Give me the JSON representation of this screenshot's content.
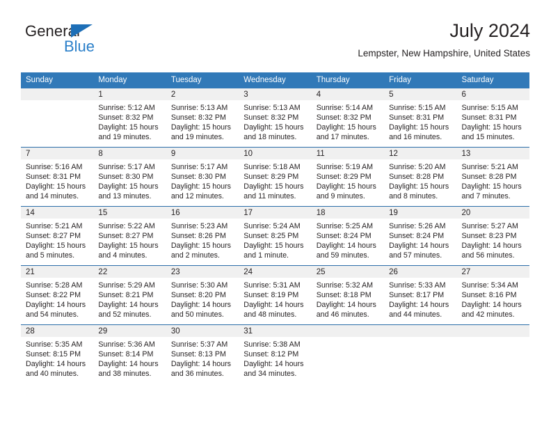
{
  "brand": {
    "name_part1": "General",
    "name_part2": "Blue",
    "triangle_color": "#1d6fb7",
    "blue_text_color": "#2a7fc9"
  },
  "header": {
    "title": "July 2024",
    "location": "Lempster, New Hampshire, United States"
  },
  "theme": {
    "header_blue": "#3179b8",
    "row_rule_blue": "#2a6ca8",
    "daynum_band_gray": "#f0f0f0",
    "text_color": "#231f20"
  },
  "weekday_headers": [
    "Sunday",
    "Monday",
    "Tuesday",
    "Wednesday",
    "Thursday",
    "Friday",
    "Saturday"
  ],
  "weeks": [
    [
      {
        "day": "",
        "sunrise": "",
        "sunset": "",
        "daylight_line1": "",
        "daylight_line2": ""
      },
      {
        "day": "1",
        "sunrise": "Sunrise: 5:12 AM",
        "sunset": "Sunset: 8:32 PM",
        "daylight_line1": "Daylight: 15 hours",
        "daylight_line2": "and 19 minutes."
      },
      {
        "day": "2",
        "sunrise": "Sunrise: 5:13 AM",
        "sunset": "Sunset: 8:32 PM",
        "daylight_line1": "Daylight: 15 hours",
        "daylight_line2": "and 19 minutes."
      },
      {
        "day": "3",
        "sunrise": "Sunrise: 5:13 AM",
        "sunset": "Sunset: 8:32 PM",
        "daylight_line1": "Daylight: 15 hours",
        "daylight_line2": "and 18 minutes."
      },
      {
        "day": "4",
        "sunrise": "Sunrise: 5:14 AM",
        "sunset": "Sunset: 8:32 PM",
        "daylight_line1": "Daylight: 15 hours",
        "daylight_line2": "and 17 minutes."
      },
      {
        "day": "5",
        "sunrise": "Sunrise: 5:15 AM",
        "sunset": "Sunset: 8:31 PM",
        "daylight_line1": "Daylight: 15 hours",
        "daylight_line2": "and 16 minutes."
      },
      {
        "day": "6",
        "sunrise": "Sunrise: 5:15 AM",
        "sunset": "Sunset: 8:31 PM",
        "daylight_line1": "Daylight: 15 hours",
        "daylight_line2": "and 15 minutes."
      }
    ],
    [
      {
        "day": "7",
        "sunrise": "Sunrise: 5:16 AM",
        "sunset": "Sunset: 8:31 PM",
        "daylight_line1": "Daylight: 15 hours",
        "daylight_line2": "and 14 minutes."
      },
      {
        "day": "8",
        "sunrise": "Sunrise: 5:17 AM",
        "sunset": "Sunset: 8:30 PM",
        "daylight_line1": "Daylight: 15 hours",
        "daylight_line2": "and 13 minutes."
      },
      {
        "day": "9",
        "sunrise": "Sunrise: 5:17 AM",
        "sunset": "Sunset: 8:30 PM",
        "daylight_line1": "Daylight: 15 hours",
        "daylight_line2": "and 12 minutes."
      },
      {
        "day": "10",
        "sunrise": "Sunrise: 5:18 AM",
        "sunset": "Sunset: 8:29 PM",
        "daylight_line1": "Daylight: 15 hours",
        "daylight_line2": "and 11 minutes."
      },
      {
        "day": "11",
        "sunrise": "Sunrise: 5:19 AM",
        "sunset": "Sunset: 8:29 PM",
        "daylight_line1": "Daylight: 15 hours",
        "daylight_line2": "and 9 minutes."
      },
      {
        "day": "12",
        "sunrise": "Sunrise: 5:20 AM",
        "sunset": "Sunset: 8:28 PM",
        "daylight_line1": "Daylight: 15 hours",
        "daylight_line2": "and 8 minutes."
      },
      {
        "day": "13",
        "sunrise": "Sunrise: 5:21 AM",
        "sunset": "Sunset: 8:28 PM",
        "daylight_line1": "Daylight: 15 hours",
        "daylight_line2": "and 7 minutes."
      }
    ],
    [
      {
        "day": "14",
        "sunrise": "Sunrise: 5:21 AM",
        "sunset": "Sunset: 8:27 PM",
        "daylight_line1": "Daylight: 15 hours",
        "daylight_line2": "and 5 minutes."
      },
      {
        "day": "15",
        "sunrise": "Sunrise: 5:22 AM",
        "sunset": "Sunset: 8:27 PM",
        "daylight_line1": "Daylight: 15 hours",
        "daylight_line2": "and 4 minutes."
      },
      {
        "day": "16",
        "sunrise": "Sunrise: 5:23 AM",
        "sunset": "Sunset: 8:26 PM",
        "daylight_line1": "Daylight: 15 hours",
        "daylight_line2": "and 2 minutes."
      },
      {
        "day": "17",
        "sunrise": "Sunrise: 5:24 AM",
        "sunset": "Sunset: 8:25 PM",
        "daylight_line1": "Daylight: 15 hours",
        "daylight_line2": "and 1 minute."
      },
      {
        "day": "18",
        "sunrise": "Sunrise: 5:25 AM",
        "sunset": "Sunset: 8:24 PM",
        "daylight_line1": "Daylight: 14 hours",
        "daylight_line2": "and 59 minutes."
      },
      {
        "day": "19",
        "sunrise": "Sunrise: 5:26 AM",
        "sunset": "Sunset: 8:24 PM",
        "daylight_line1": "Daylight: 14 hours",
        "daylight_line2": "and 57 minutes."
      },
      {
        "day": "20",
        "sunrise": "Sunrise: 5:27 AM",
        "sunset": "Sunset: 8:23 PM",
        "daylight_line1": "Daylight: 14 hours",
        "daylight_line2": "and 56 minutes."
      }
    ],
    [
      {
        "day": "21",
        "sunrise": "Sunrise: 5:28 AM",
        "sunset": "Sunset: 8:22 PM",
        "daylight_line1": "Daylight: 14 hours",
        "daylight_line2": "and 54 minutes."
      },
      {
        "day": "22",
        "sunrise": "Sunrise: 5:29 AM",
        "sunset": "Sunset: 8:21 PM",
        "daylight_line1": "Daylight: 14 hours",
        "daylight_line2": "and 52 minutes."
      },
      {
        "day": "23",
        "sunrise": "Sunrise: 5:30 AM",
        "sunset": "Sunset: 8:20 PM",
        "daylight_line1": "Daylight: 14 hours",
        "daylight_line2": "and 50 minutes."
      },
      {
        "day": "24",
        "sunrise": "Sunrise: 5:31 AM",
        "sunset": "Sunset: 8:19 PM",
        "daylight_line1": "Daylight: 14 hours",
        "daylight_line2": "and 48 minutes."
      },
      {
        "day": "25",
        "sunrise": "Sunrise: 5:32 AM",
        "sunset": "Sunset: 8:18 PM",
        "daylight_line1": "Daylight: 14 hours",
        "daylight_line2": "and 46 minutes."
      },
      {
        "day": "26",
        "sunrise": "Sunrise: 5:33 AM",
        "sunset": "Sunset: 8:17 PM",
        "daylight_line1": "Daylight: 14 hours",
        "daylight_line2": "and 44 minutes."
      },
      {
        "day": "27",
        "sunrise": "Sunrise: 5:34 AM",
        "sunset": "Sunset: 8:16 PM",
        "daylight_line1": "Daylight: 14 hours",
        "daylight_line2": "and 42 minutes."
      }
    ],
    [
      {
        "day": "28",
        "sunrise": "Sunrise: 5:35 AM",
        "sunset": "Sunset: 8:15 PM",
        "daylight_line1": "Daylight: 14 hours",
        "daylight_line2": "and 40 minutes."
      },
      {
        "day": "29",
        "sunrise": "Sunrise: 5:36 AM",
        "sunset": "Sunset: 8:14 PM",
        "daylight_line1": "Daylight: 14 hours",
        "daylight_line2": "and 38 minutes."
      },
      {
        "day": "30",
        "sunrise": "Sunrise: 5:37 AM",
        "sunset": "Sunset: 8:13 PM",
        "daylight_line1": "Daylight: 14 hours",
        "daylight_line2": "and 36 minutes."
      },
      {
        "day": "31",
        "sunrise": "Sunrise: 5:38 AM",
        "sunset": "Sunset: 8:12 PM",
        "daylight_line1": "Daylight: 14 hours",
        "daylight_line2": "and 34 minutes."
      },
      {
        "day": "",
        "sunrise": "",
        "sunset": "",
        "daylight_line1": "",
        "daylight_line2": ""
      },
      {
        "day": "",
        "sunrise": "",
        "sunset": "",
        "daylight_line1": "",
        "daylight_line2": ""
      },
      {
        "day": "",
        "sunrise": "",
        "sunset": "",
        "daylight_line1": "",
        "daylight_line2": ""
      }
    ]
  ]
}
